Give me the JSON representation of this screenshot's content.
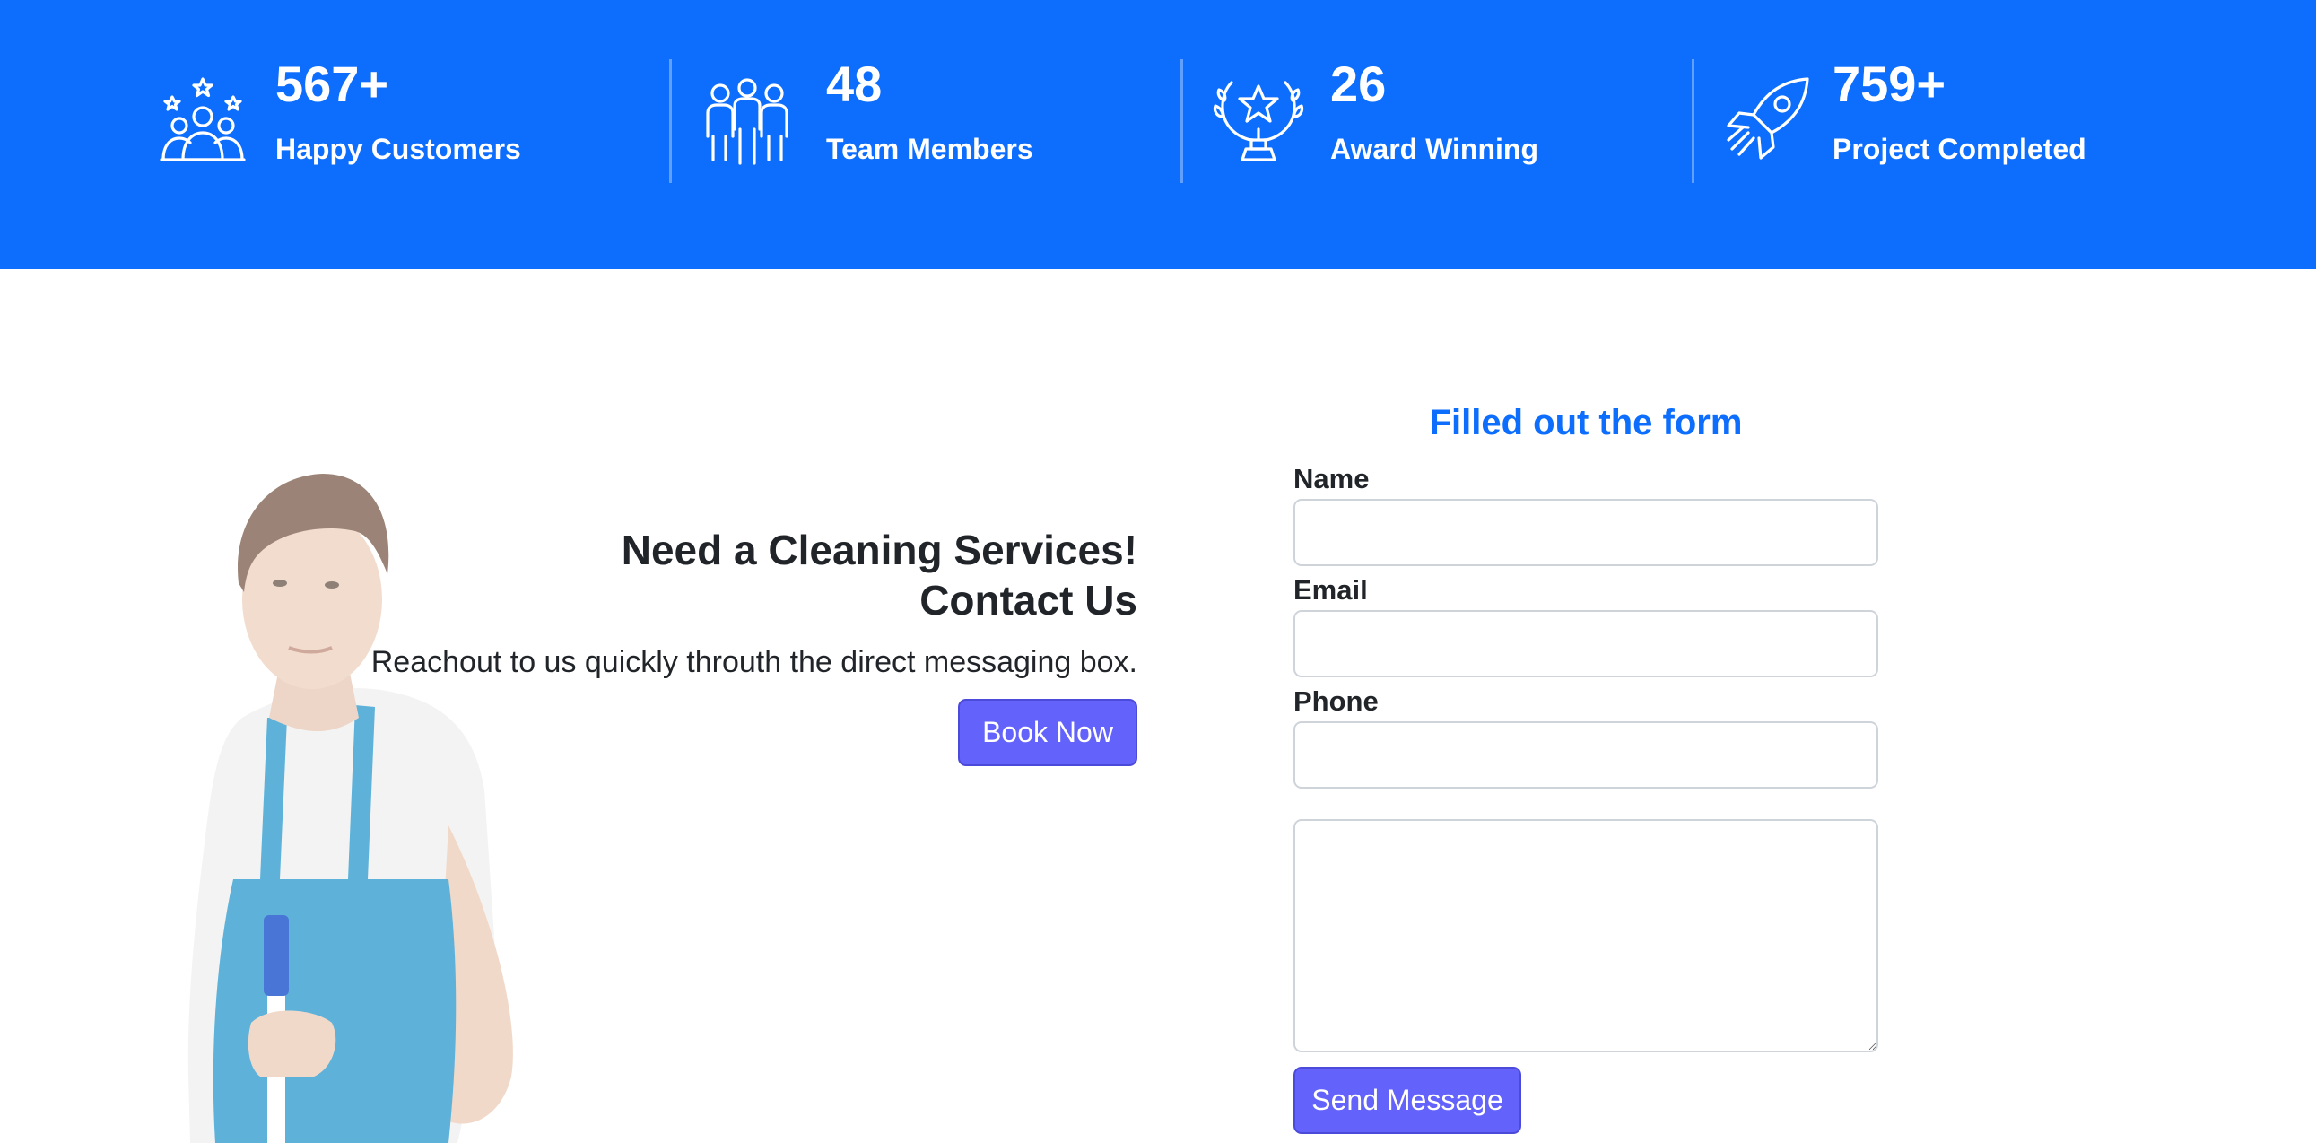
{
  "stats": [
    {
      "icon": "customers-stars-icon",
      "value": "567+",
      "label": "Happy Customers"
    },
    {
      "icon": "team-members-icon",
      "value": "48",
      "label": "Team Members"
    },
    {
      "icon": "award-trophy-icon",
      "value": "26",
      "label": "Award Winning"
    },
    {
      "icon": "rocket-icon",
      "value": "759+",
      "label": "Project Completed"
    }
  ],
  "cta": {
    "heading_line1": "Need a Cleaning Services!",
    "heading_line2": "Contact Us",
    "text": "Reachout to us quickly throuth the direct messaging box.",
    "button_label": "Book Now"
  },
  "form": {
    "title": "Filled out the form",
    "name_label": "Name",
    "name_value": "",
    "email_label": "Email",
    "email_value": "",
    "phone_label": "Phone",
    "phone_value": "",
    "message_value": "",
    "submit_label": "Send Message"
  },
  "colors": {
    "banner": "#0d6efd",
    "accent_button": "#6362fb",
    "form_title": "#0d6efd"
  }
}
